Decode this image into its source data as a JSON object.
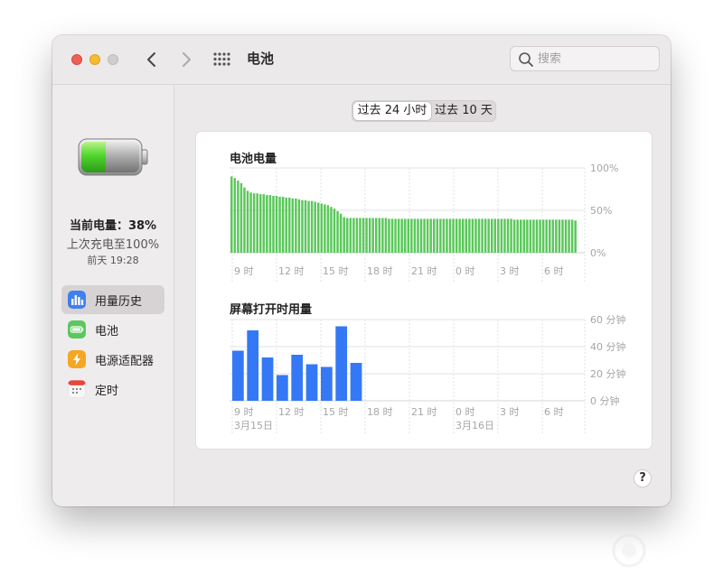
{
  "window": {
    "title": "电池",
    "search_placeholder": "搜索"
  },
  "sidebar": {
    "current_level": "当前电量：38%",
    "last_charge": "上次充电至100%",
    "last_charge_time": "前天 19:28",
    "items": [
      {
        "label": "用量历史",
        "icon": "bar-chart-icon",
        "active": true
      },
      {
        "label": "电池",
        "icon": "battery-icon",
        "active": false
      },
      {
        "label": "电源适配器",
        "icon": "lightning-icon",
        "active": false
      },
      {
        "label": "定时",
        "icon": "calendar-icon",
        "active": false
      }
    ]
  },
  "segment": {
    "options": [
      "过去 24 小时",
      "过去 10 天"
    ],
    "selected": "过去 24 小时"
  },
  "help_label": "?",
  "colors": {
    "battery_green": "#5ac85a",
    "screen_blue": "#3478f6",
    "window_bg": "#ece9eb"
  },
  "chart_data": [
    {
      "type": "bar",
      "title": "电池电量",
      "x_tick_labels": [
        "9 时",
        "12 时",
        "15 时",
        "18 时",
        "21 时",
        "0 时",
        "3 时",
        "6 时"
      ],
      "y_tick_labels": [
        "100%",
        "50%",
        "0%"
      ],
      "ylim": [
        0,
        100
      ],
      "unit": "%",
      "grid": true,
      "color": "#5ac85a",
      "values": [
        90,
        88,
        85,
        82,
        77,
        73,
        71,
        70,
        70,
        69,
        69,
        68,
        68,
        67,
        67,
        66,
        66,
        65,
        65,
        64,
        64,
        63,
        62,
        62,
        61,
        61,
        60,
        59,
        58,
        57,
        56,
        54,
        52,
        49,
        46,
        42,
        41,
        41,
        41,
        41,
        41,
        41,
        41,
        41,
        41,
        41,
        41,
        41,
        41,
        40,
        40,
        40,
        40,
        40,
        40,
        40,
        40,
        40,
        40,
        40,
        40,
        40,
        40,
        40,
        40,
        40,
        40,
        40,
        40,
        40,
        40,
        40,
        40,
        40,
        40,
        40,
        40,
        40,
        40,
        40,
        40,
        40,
        40,
        40,
        40,
        40,
        40,
        40,
        39,
        39,
        39,
        39,
        39,
        39,
        39,
        39,
        39,
        39,
        39,
        39,
        39,
        39,
        39,
        39,
        39,
        39,
        39,
        38
      ]
    },
    {
      "type": "bar",
      "title": "屏幕打开时用量",
      "x_tick_labels": [
        "9 时",
        "12 时",
        "15 时",
        "18 时",
        "21 时",
        "0 时",
        "3 时",
        "6 时"
      ],
      "date_labels": [
        "3月15日",
        "3月16日"
      ],
      "y_tick_labels": [
        "60 分钟",
        "40 分钟",
        "20 分钟",
        "0 分钟"
      ],
      "ylim": [
        0,
        60
      ],
      "unit": "分钟",
      "grid": true,
      "color": "#3478f6",
      "values": [
        37,
        52,
        32,
        19,
        34,
        27,
        25,
        55,
        28
      ]
    }
  ]
}
